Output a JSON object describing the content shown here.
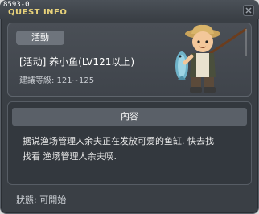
{
  "window": {
    "quest_code": "8593-0",
    "title": "QUEST INFO",
    "close_icon": "close-icon"
  },
  "quest": {
    "tag": "活動",
    "name": "[活动] 养小鱼(LV121以上)",
    "level_requirement": "建議等級: 121~125",
    "npc_icon": "fisherman-npc-icon"
  },
  "content": {
    "header": "內容",
    "description_line1": "据说渔场管理人余夫正在发放可爱的鱼缸. 快去找",
    "description_line2": "找看 渔场管理人余夫喫."
  },
  "status": {
    "text": "狀態: 可開始"
  },
  "colors": {
    "window_bg": "#3a3f45",
    "title_text": "#e8d27a",
    "panel_bg": "#33383e"
  }
}
